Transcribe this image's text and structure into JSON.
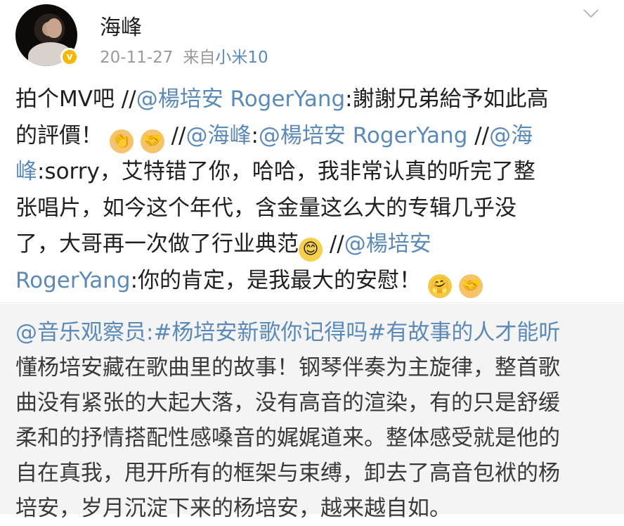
{
  "header": {
    "username": "海峰",
    "date": "20-11-27",
    "source_prefix": "来自",
    "device": "小米10",
    "verified_badge": "v"
  },
  "post": {
    "l1_a": "拍个MV吧 //",
    "l1_m": "@楊培安 RogerYang",
    "l1_b": ":謝謝兄弟給予如此高",
    "l2_a": "的評價！",
    "l2_sep": " //",
    "l2_m1": "@海峰",
    "l2_b": ":",
    "l2_m2": "@楊培安 RogerYang",
    "l2_sep2": " //",
    "l2_m3": "@海",
    "l3_m": "峰",
    "l3_b": ":sorry，艾特错了你，哈哈，我非常认真的听完了整",
    "l4": "张唱片，如今这个年代，含金量这么大的专辑几乎没",
    "l5_a": "了，大哥再一次做了行业典范",
    "l5_sep": " //",
    "l5_m": "@楊培安",
    "l6_m": "RogerYang",
    "l6_b": ":你的肯定，是我最大的安慰！"
  },
  "emoji": {
    "clap": "👏",
    "handshake": "🤝",
    "smile": "😊",
    "hug": "🤗"
  },
  "repost": {
    "l1_m": "@音乐观察员",
    "l1_b": ":#杨培安新歌你记得吗#有故事的人才能听",
    "l2": "懂杨培安藏在歌曲里的故事！钢琴伴奏为主旋律，整首歌",
    "l3": "曲没有紧张的大起大落，没有高音的渲染，有的只是舒缓",
    "l4": "柔和的抒情搭配性感嗓音的娓娓道来。整体感受就是他的",
    "l5": "自在真我，甩开所有的框架与束缚，卸去了高音包袱的杨",
    "l6": "培安，岁月沉淀下来的杨培安，越来越自如。"
  },
  "colors": {
    "link": "#5b8ab9",
    "meta": "#9a9a9a",
    "repost_bg": "#f4f4f4",
    "badge": "#f5b700"
  }
}
